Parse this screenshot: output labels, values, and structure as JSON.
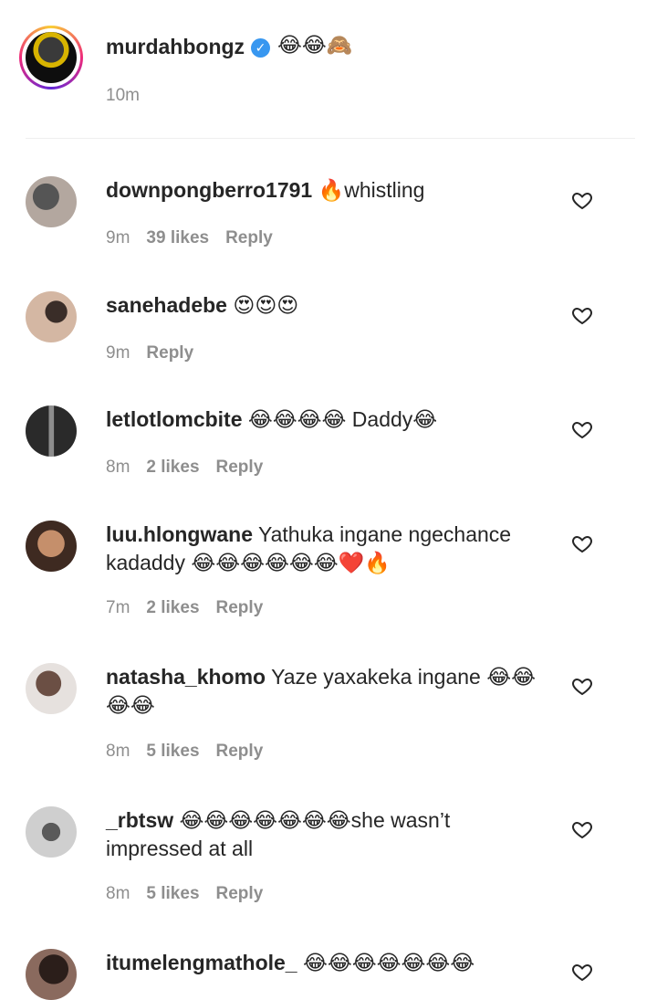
{
  "caption": {
    "username": "murdahbongz",
    "text": "😂😂🙈",
    "time": "10m"
  },
  "comments": [
    {
      "username": "downpongberro1791",
      "text": "🔥whistling",
      "time": "9m",
      "likes": "39 likes",
      "reply": "Reply"
    },
    {
      "username": "sanehadebe",
      "text": "😍😍😍",
      "time": "9m",
      "likes": "",
      "reply": "Reply"
    },
    {
      "username": "letlotlomcbite",
      "text": "😂😂😂😂 Daddy😂",
      "time": "8m",
      "likes": "2 likes",
      "reply": "Reply"
    },
    {
      "username": "luu.hlongwane",
      "text": "Yathuka ingane ngechance kadaddy 😂😂😂😂😂😂❤️🔥",
      "time": "7m",
      "likes": "2 likes",
      "reply": "Reply"
    },
    {
      "username": "natasha_khomo",
      "text": "Yaze yaxakeka ingane 😂😂😂😂",
      "time": "8m",
      "likes": "5 likes",
      "reply": "Reply"
    },
    {
      "username": "_rbtsw",
      "text": "😂😂😂😂😂😂😂she wasn’t impressed at all",
      "time": "8m",
      "likes": "5 likes",
      "reply": "Reply"
    },
    {
      "username": "itumelengmathole_",
      "text": "😂😂😂😂😂😂😂",
      "time": "",
      "likes": "",
      "reply": ""
    }
  ],
  "colors": {
    "verified": "#3897f0",
    "text": "#262626",
    "secondary": "#8e8e8e"
  },
  "icons": {
    "verified": "verified-badge-icon",
    "like": "heart-outline-icon"
  }
}
